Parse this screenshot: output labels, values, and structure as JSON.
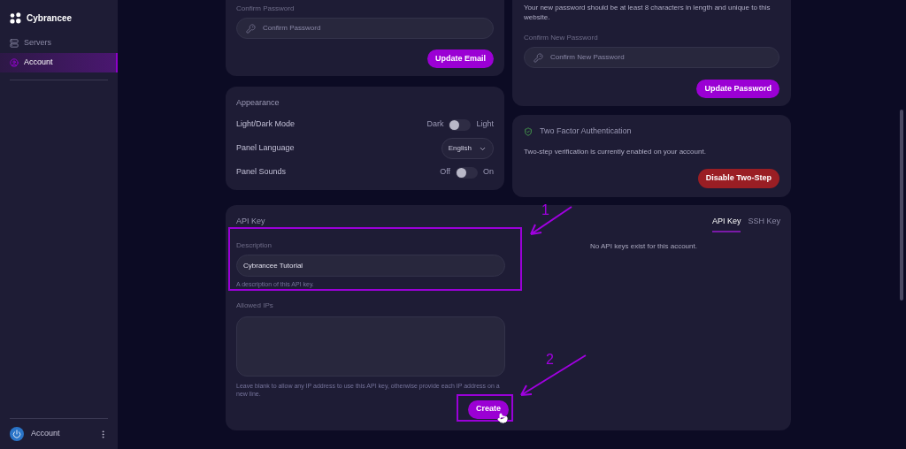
{
  "sidebar": {
    "brand": "Cybrancee",
    "items": [
      {
        "label": "Servers",
        "selected": false
      },
      {
        "label": "Account",
        "selected": true
      }
    ],
    "footer": {
      "label": "Account"
    }
  },
  "email_card": {
    "field_label": "Confirm Password",
    "placeholder": "Confirm Password",
    "button": "Update Email"
  },
  "appearance": {
    "title": "Appearance",
    "rows": [
      {
        "kind": "toggle",
        "label": "Light/Dark Mode",
        "off_label": "Dark",
        "on_label": "Light",
        "on": false
      },
      {
        "kind": "select",
        "label": "Panel Language",
        "value": "English"
      },
      {
        "kind": "toggle",
        "label": "Panel Sounds",
        "off_label": "Off",
        "on_label": "On",
        "on": false
      }
    ]
  },
  "password_card": {
    "note": "Your new password should be at least 8 characters in length and unique to this website.",
    "field_label": "Confirm New Password",
    "placeholder": "Confirm New Password",
    "button": "Update Password"
  },
  "two_factor": {
    "title": "Two Factor Authentication",
    "text": "Two-step verification is currently enabled on your account.",
    "button": "Disable Two-Step"
  },
  "api_key": {
    "title": "API Key",
    "description_label": "Description",
    "description_value": "Cybrancee Tutorial",
    "description_hint": "A description of this API key.",
    "ips_label": "Allowed IPs",
    "ips_hint": "Leave blank to allow any IP address to use this API key, otherwise provide each IP address on a new line.",
    "button": "Create",
    "tabs": [
      {
        "label": "API Key",
        "selected": true
      },
      {
        "label": "SSH Key",
        "selected": false
      }
    ],
    "empty": "No API keys exist for this account."
  },
  "annotations": [
    {
      "number": "1"
    },
    {
      "number": "2"
    }
  ]
}
